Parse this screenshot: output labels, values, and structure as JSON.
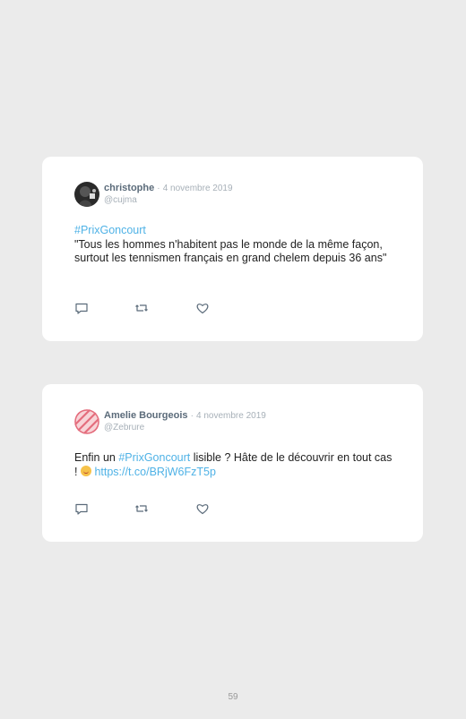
{
  "tweets": [
    {
      "name": "christophe",
      "separator": "·",
      "date": "4 novembre 2019",
      "handle": "@cujma",
      "hashtag": "#PrixGoncourt",
      "body": "\"Tous les hommes n'habitent pas le monde de la même façon, surtout les tennismen français en grand chelem depuis 36 ans\""
    },
    {
      "name": "Amelie Bourgeois",
      "separator": "·",
      "date": "4 novembre 2019",
      "handle": "@Zebrure",
      "text_before": "Enfin un ",
      "hashtag": "#PrixGoncourt",
      "text_after": " lisible ? Hâte de le découvrir en tout cas ! ",
      "emoji": "smiling-face-emoji",
      "link": "https://t.co/BRjW6FzT5p"
    }
  ],
  "icons": [
    "reply-icon",
    "retweet-icon",
    "like-icon"
  ],
  "page_number": "59"
}
